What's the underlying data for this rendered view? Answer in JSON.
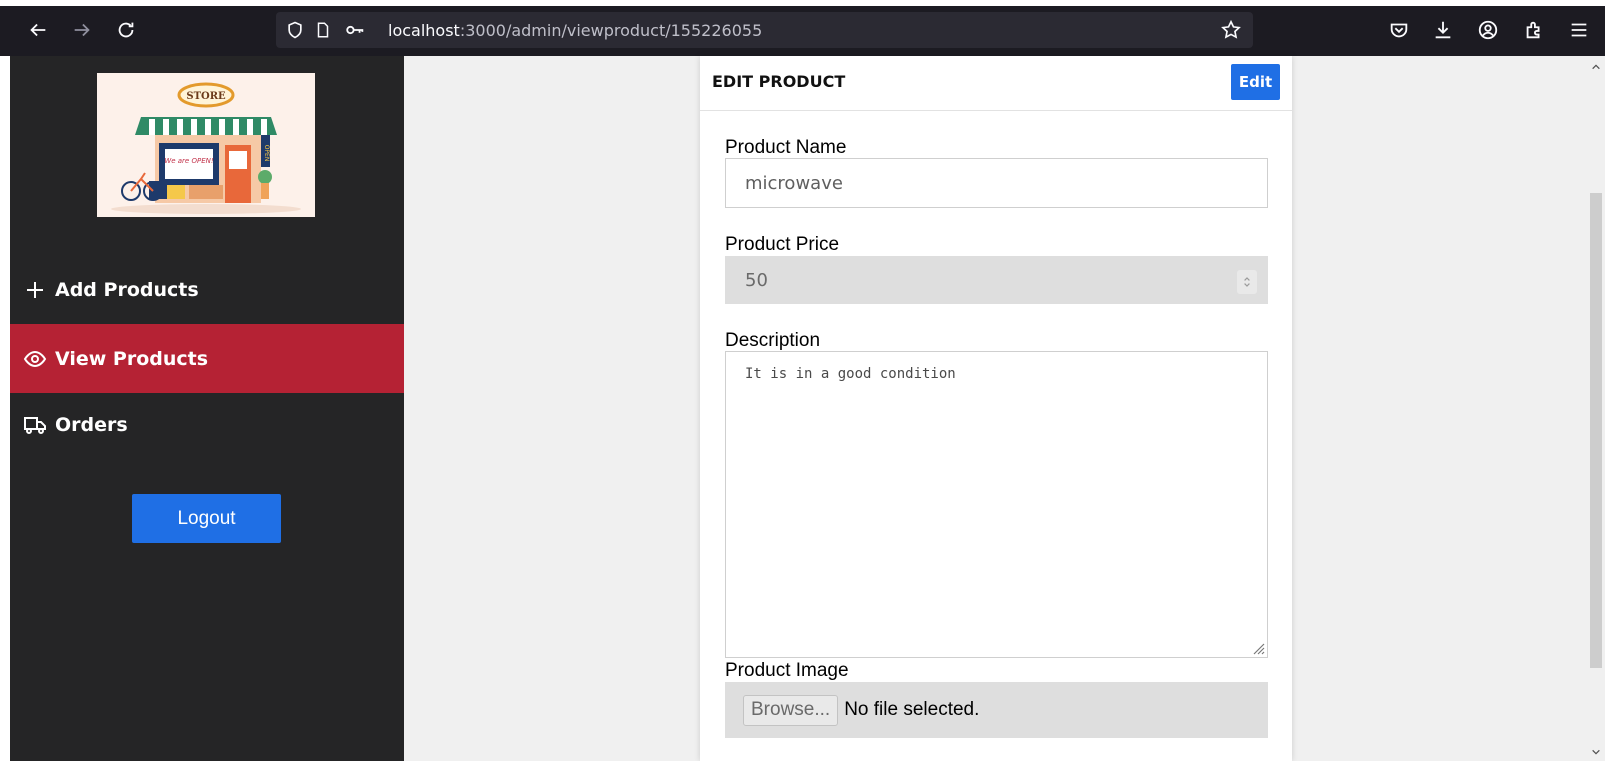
{
  "browser": {
    "url_host": "localhost",
    "url_path": ":3000/admin/viewproduct/155226055"
  },
  "sidebar": {
    "logo_text": "STORE",
    "logo_sign_text": "We are OPEN!",
    "logo_vertical_text": "OPEN",
    "items": [
      {
        "label": "Add Products",
        "icon": "plus-icon"
      },
      {
        "label": "View Products",
        "icon": "eye-icon",
        "active": true
      },
      {
        "label": "Orders",
        "icon": "truck-icon"
      }
    ],
    "logout_label": "Logout",
    "active_color": "#b52234"
  },
  "card": {
    "title": "EDIT PRODUCT",
    "edit_label": "Edit",
    "fields": {
      "name_label": "Product Name",
      "name_value": "microwave",
      "price_label": "Product Price",
      "price_value": "50",
      "description_label": "Description",
      "description_value": "It is in a good condition",
      "image_label": "Product Image",
      "browse_label": "Browse...",
      "file_status": "No file selected."
    }
  },
  "colors": {
    "primary_button": "#1f6fe5",
    "sidebar_bg": "#252526"
  }
}
